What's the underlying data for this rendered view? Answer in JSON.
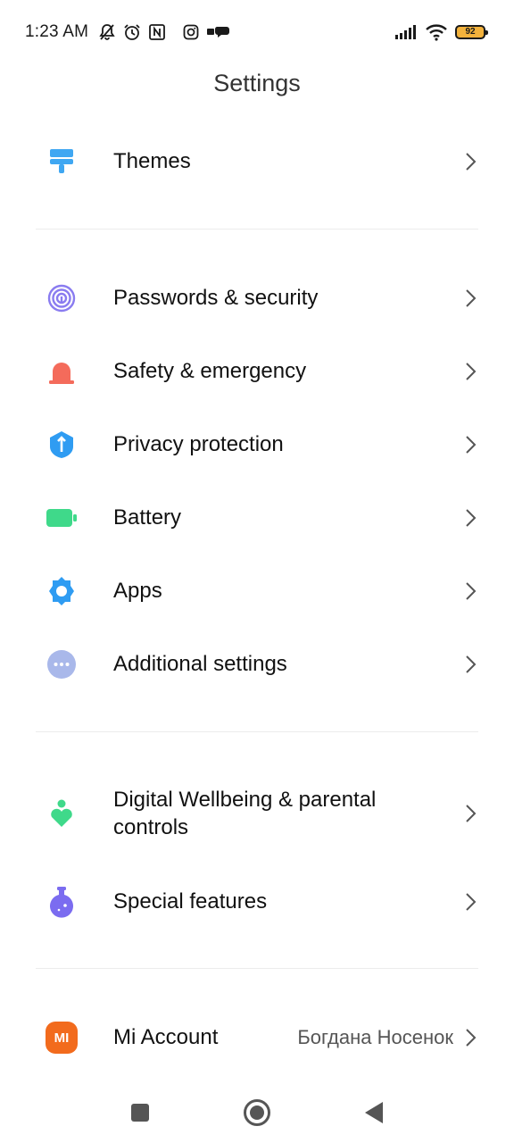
{
  "status_bar": {
    "time": "1:23 AM",
    "battery_level": "92",
    "left_icons": [
      "bell-off-icon",
      "alarm-icon",
      "nfc-icon",
      "instagram-icon",
      "chat-icon"
    ],
    "right_icons": [
      "signal-icon",
      "wifi-icon",
      "battery-icon"
    ],
    "battery_color": "#f3b23c"
  },
  "header": {
    "title": "Settings"
  },
  "items": {
    "themes": {
      "label": "Themes",
      "icon": "paint-roller-icon",
      "color": "#3fa7f2"
    },
    "passwords": {
      "label": "Passwords & security",
      "icon": "fingerprint-icon",
      "color": "#8a7cf0"
    },
    "safety": {
      "label": "Safety & emergency",
      "icon": "siren-icon",
      "color": "#f46b5b"
    },
    "privacy": {
      "label": "Privacy protection",
      "icon": "shield-icon",
      "color": "#2f9cf2"
    },
    "battery": {
      "label": "Battery",
      "icon": "battery-icon",
      "color": "#3fd98a"
    },
    "apps": {
      "label": "Apps",
      "icon": "gear-icon",
      "color": "#2f9cf2"
    },
    "additional": {
      "label": "Additional settings",
      "icon": "more-icon",
      "color": "#a9b8ea"
    },
    "wellbeing": {
      "label_line1": "Digital Wellbeing & parental",
      "label_line2": "controls",
      "icon": "wellbeing-icon",
      "color": "#3fd98a"
    },
    "special": {
      "label": "Special features",
      "icon": "flask-icon",
      "color": "#7b6cf0"
    },
    "mi_account": {
      "label": "Mi Account",
      "value": "Богдана Носенок",
      "icon": "mi-logo-icon",
      "color": "#f26b1d",
      "logo_text": "MI"
    }
  },
  "nav_bar": {
    "buttons": [
      "recents-button",
      "home-button",
      "back-button"
    ]
  }
}
